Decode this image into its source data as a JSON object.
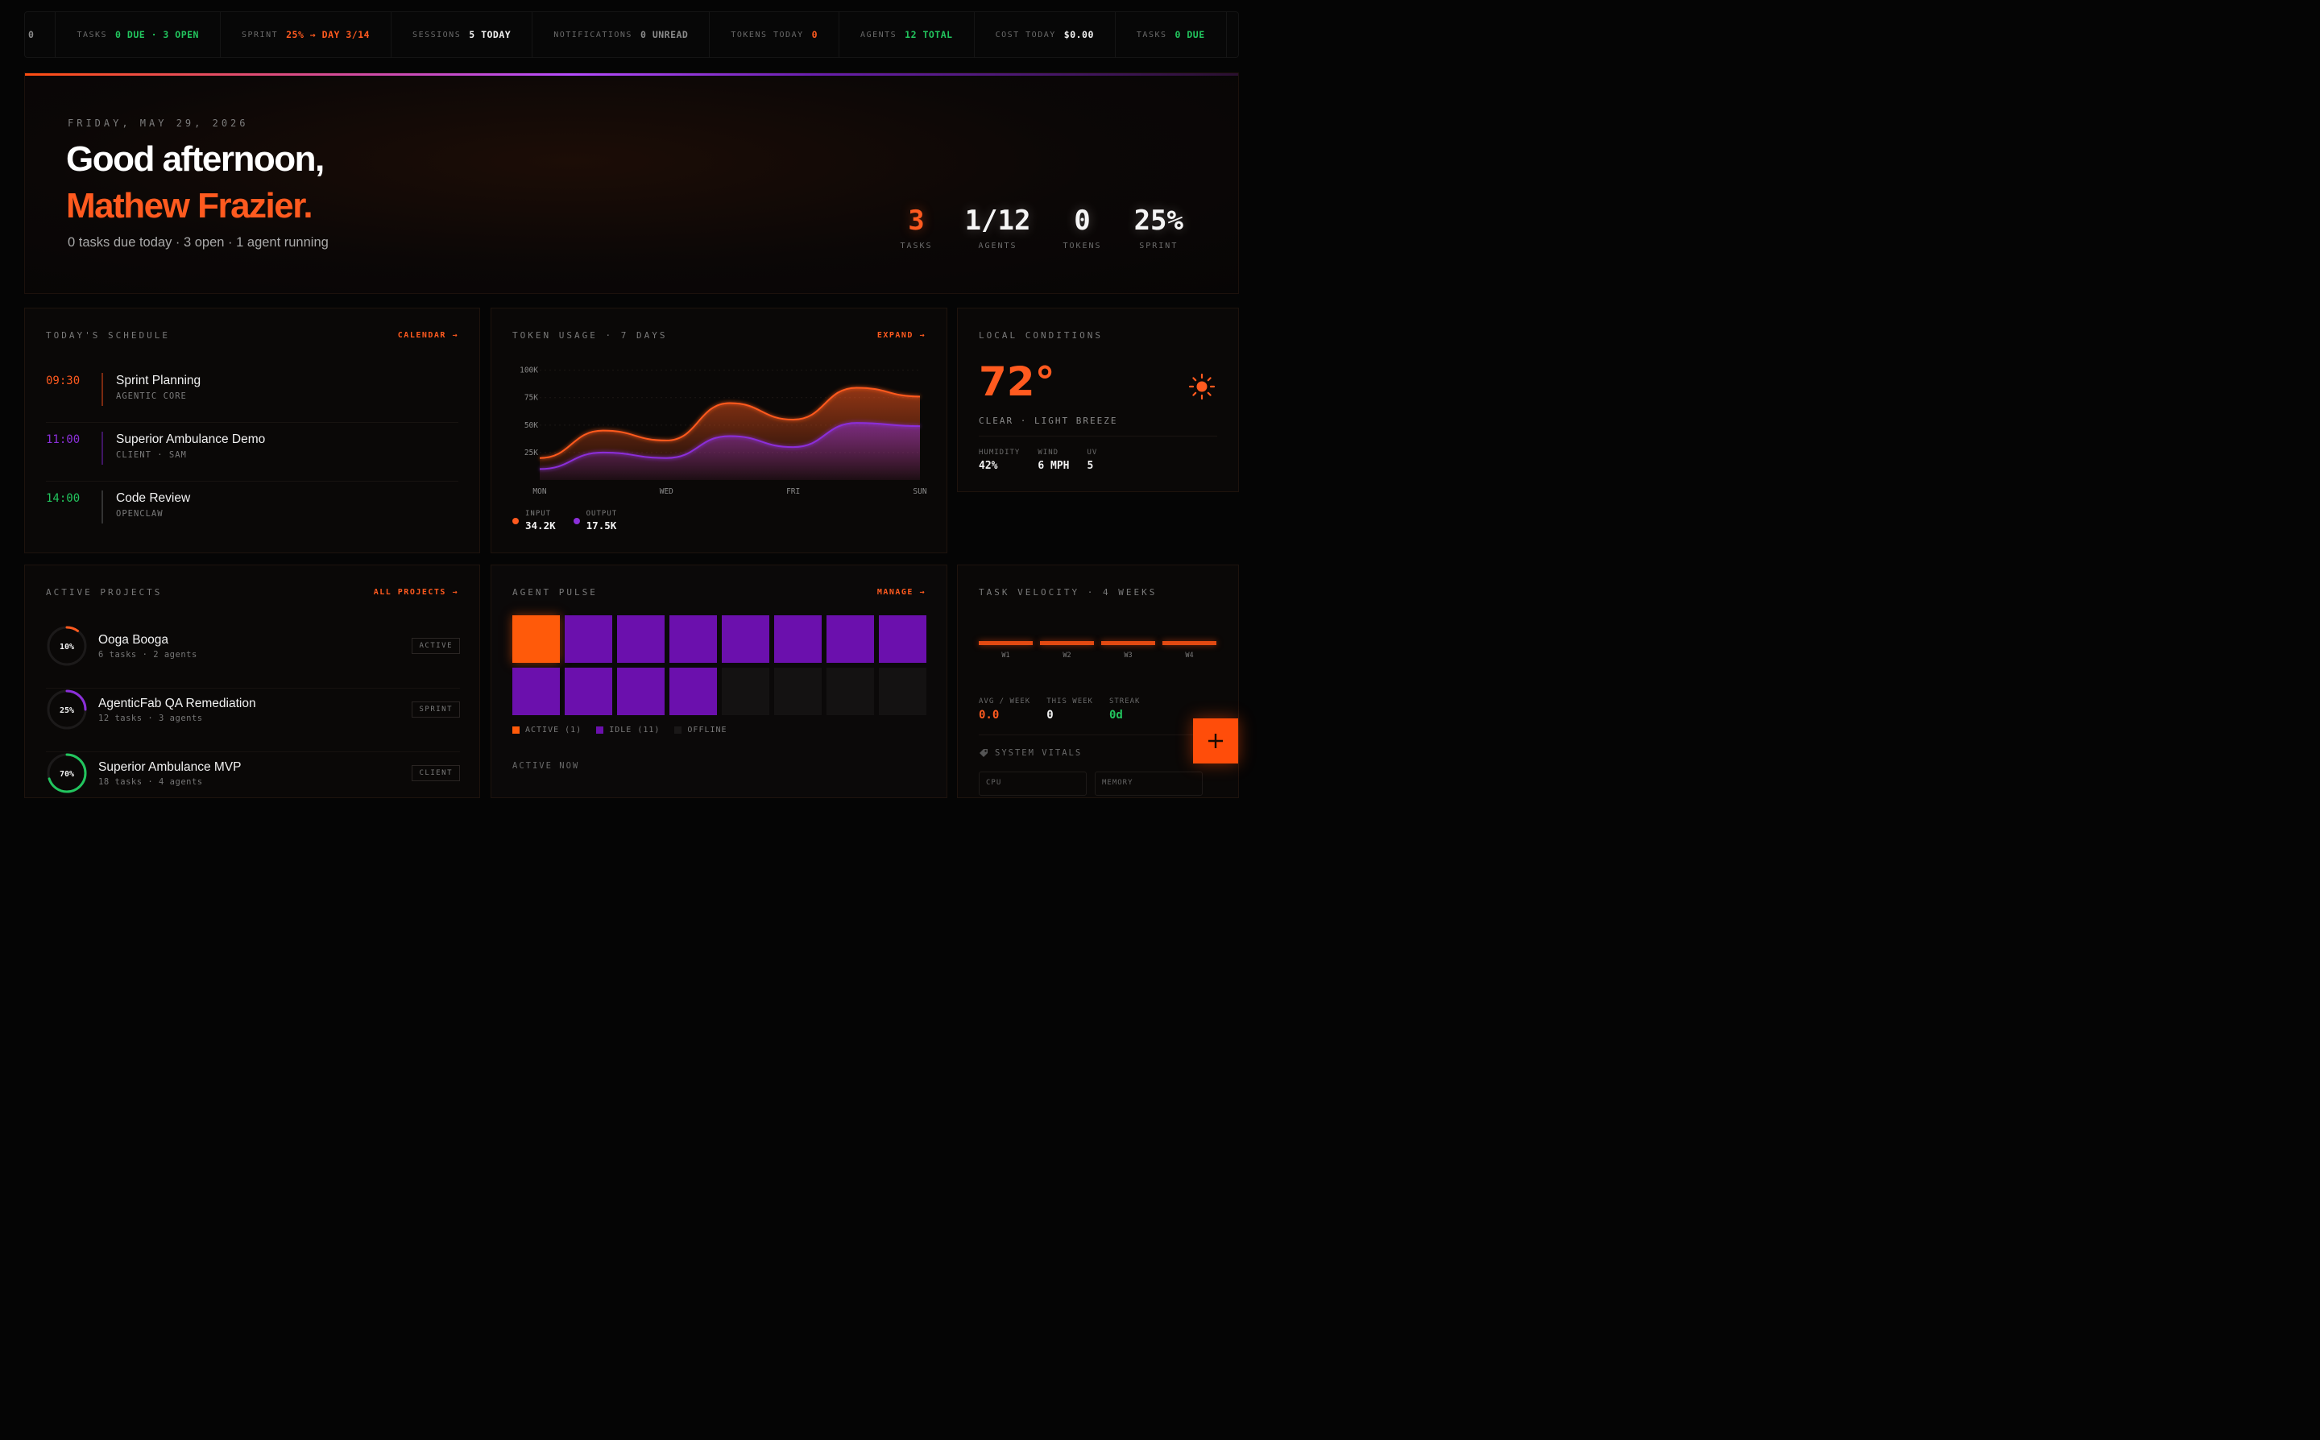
{
  "ticker": {
    "lead": "0",
    "items": [
      {
        "label": "TASKS",
        "value": "0 DUE · 3 OPEN",
        "color": "#22c55e"
      },
      {
        "label": "SPRINT",
        "value": "25% → DAY 3/14",
        "color": "#ff5a1f"
      },
      {
        "label": "SESSIONS",
        "value": "5 TODAY",
        "color": "#f2f2f2"
      },
      {
        "label": "NOTIFICATIONS",
        "value": "0 UNREAD",
        "color": "#8a8a8a"
      },
      {
        "label": "TOKENS TODAY",
        "value": "0",
        "color": "#ff5a1f"
      },
      {
        "label": "AGENTS",
        "value": "12 TOTAL",
        "color": "#22c55e"
      },
      {
        "label": "COST TODAY",
        "value": "$0.00",
        "color": "#f2f2f2"
      },
      {
        "label": "TASKS",
        "value": "0 DUE",
        "color": "#22c55e"
      }
    ]
  },
  "hero": {
    "date": "FRIDAY, MAY 29, 2026",
    "greeting": "Good afternoon,",
    "name": "Mathew Frazier.",
    "summary": "0 tasks due today · 3 open · 1 agent running",
    "stats": [
      {
        "value": "3",
        "label": "TASKS"
      },
      {
        "value": "1/12",
        "label": "AGENTS"
      },
      {
        "value": "0",
        "label": "TOKENS"
      },
      {
        "value": "25%",
        "label": "SPRINT"
      }
    ]
  },
  "schedule": {
    "title": "TODAY'S SCHEDULE",
    "link": "CALENDAR →",
    "items": [
      {
        "time": "09:30",
        "title": "Sprint Planning",
        "sub": "AGENTIC CORE",
        "color": "#ff5a1f"
      },
      {
        "time": "11:00",
        "title": "Superior Ambulance Demo",
        "sub": "CLIENT · SAM",
        "color": "#8b2fd9"
      },
      {
        "time": "14:00",
        "title": "Code Review",
        "sub": "OPENCLAW",
        "color": "#22c55e"
      }
    ]
  },
  "tokens": {
    "title": "TOKEN USAGE · 7 DAYS",
    "link": "EXPAND →",
    "legend": [
      {
        "name": "INPUT",
        "value": "34.2K",
        "color": "#ff5a1f"
      },
      {
        "name": "OUTPUT",
        "value": "17.5K",
        "color": "#8b2fd9"
      }
    ]
  },
  "chart_data": {
    "type": "area",
    "title": "TOKEN USAGE · 7 DAYS",
    "x_tick_labels": [
      "MON",
      "WED",
      "FRI",
      "SUN"
    ],
    "y_tick_labels": [
      "100K",
      "75K",
      "50K",
      "25K"
    ],
    "ylim": [
      0,
      110000
    ],
    "x": [
      0,
      1,
      2,
      3,
      4,
      5,
      6
    ],
    "series": [
      {
        "name": "INPUT",
        "color": "#ff5a1f",
        "values": [
          20000,
          45000,
          36000,
          70000,
          55000,
          84000,
          76000
        ]
      },
      {
        "name": "OUTPUT",
        "color": "#8b2fd9",
        "values": [
          10000,
          25000,
          20000,
          40000,
          30000,
          52000,
          49000
        ]
      }
    ],
    "grid": true
  },
  "weather": {
    "title": "LOCAL CONDITIONS",
    "temp": "72°",
    "conditions": "CLEAR · LIGHT BREEZE",
    "icon": "sun-icon",
    "stats": [
      {
        "label": "HUMIDITY",
        "value": "42%"
      },
      {
        "label": "WIND",
        "value": "6 MPH"
      },
      {
        "label": "UV",
        "value": "5"
      }
    ]
  },
  "projects": {
    "title": "ACTIVE PROJECTS",
    "link": "ALL PROJECTS →",
    "items": [
      {
        "pct": "10%",
        "progress": 0.1,
        "name": "Ooga Booga",
        "sub": "6 tasks · 2 agents",
        "badge": "ACTIVE",
        "color": "#ff5a1f"
      },
      {
        "pct": "25%",
        "progress": 0.25,
        "name": "AgenticFab QA Remediation",
        "sub": "12 tasks · 3 agents",
        "badge": "SPRINT",
        "color": "#8b2fd9"
      },
      {
        "pct": "70%",
        "progress": 0.7,
        "name": "Superior Ambulance MVP",
        "sub": "18 tasks · 4 agents",
        "badge": "CLIENT",
        "color": "#22c55e"
      }
    ]
  },
  "pulse": {
    "title": "AGENT PULSE",
    "link": "MANAGE →",
    "cells": [
      "active",
      "idle",
      "idle",
      "idle",
      "idle",
      "idle",
      "idle",
      "idle",
      "idle",
      "idle",
      "idle",
      "idle",
      "off",
      "off",
      "off",
      "off"
    ],
    "legend": [
      {
        "label": "ACTIVE (1)",
        "color": "#ff5a0a"
      },
      {
        "label": "IDLE (11)",
        "color": "#6b10ad"
      },
      {
        "label": "OFFLINE",
        "color": "#1a1818"
      }
    ],
    "active_now": "ACTIVE NOW"
  },
  "velocity": {
    "title": "TASK VELOCITY · 4 WEEKS",
    "weeks": [
      "W1",
      "W2",
      "W3",
      "W4"
    ],
    "stats": [
      {
        "label": "AVG / WEEK",
        "value": "0.0",
        "color": "#ff5a1f"
      },
      {
        "label": "THIS WEEK",
        "value": "0",
        "color": "#f2f2f2"
      },
      {
        "label": "STREAK",
        "value": "0d",
        "color": "#22c55e"
      }
    ],
    "vitals_title": "SYSTEM VITALS",
    "vitals": [
      "CPU",
      "MEMORY"
    ]
  },
  "fab": {
    "icon": "plus-icon"
  }
}
